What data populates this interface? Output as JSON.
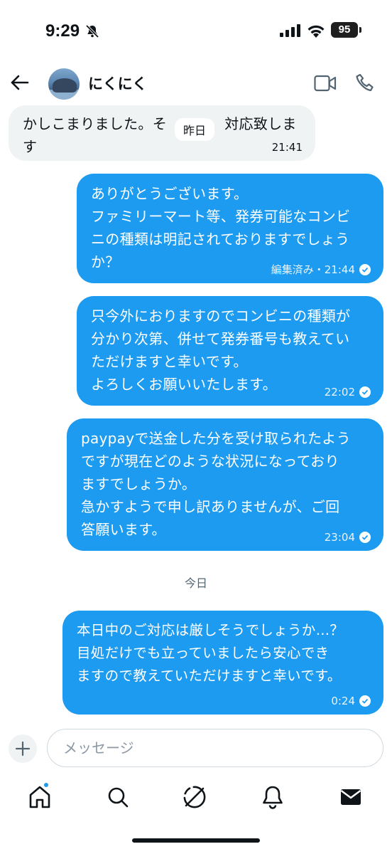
{
  "status_bar": {
    "time": "9:29",
    "battery": "95",
    "icons": [
      "bell-slash-icon",
      "signal-icon",
      "wifi-icon",
      "battery-icon"
    ]
  },
  "header": {
    "contact_name": "にくにく",
    "icons": [
      "back-arrow-icon",
      "avatar",
      "video-call-icon",
      "phone-icon"
    ]
  },
  "messages": [
    {
      "direction": "incoming",
      "text": "かしこまりました。そ　　　　対応致します",
      "meta": "21:41"
    },
    {
      "direction": "outgoing",
      "text": "ありがとうございます。\nファミリーマート等、発券可能なコンビ\nニの種類は明記されておりますでしょう\nか？",
      "meta": "編集済み・21:44"
    },
    {
      "direction": "outgoing",
      "text": "只今外におりますのでコンビニの種類が\n分かり次第、併せて発券番号も教えてい\nただけますと幸いです。\nよろしくお願いいたします。",
      "meta": "22:02"
    },
    {
      "direction": "outgoing",
      "text": "paypayで送金した分を受け取られたよう\nですが現在どのような状況になっており\nますでしょうか。\n急かすようで申し訳ありませんが、ご回\n答願います。",
      "meta": "23:04"
    },
    {
      "direction": "outgoing",
      "text": "本日中のご対応は厳しそうでしょうか…？\n目処だけでも立っていましたら安心でき\nますので教えていただけますと幸いです。",
      "meta": "0:24"
    }
  ],
  "date_labels": {
    "yesterday": "昨日",
    "today": "今日"
  },
  "composer": {
    "placeholder": "メッセージ"
  },
  "tabbar": {
    "items": [
      "home-icon",
      "search-icon",
      "grok-icon",
      "notifications-icon",
      "messages-icon"
    ]
  },
  "colors": {
    "outgoing_bubble": "#1d9bf0",
    "incoming_bubble": "#eff3f4",
    "accent": "#1d9bf0"
  }
}
